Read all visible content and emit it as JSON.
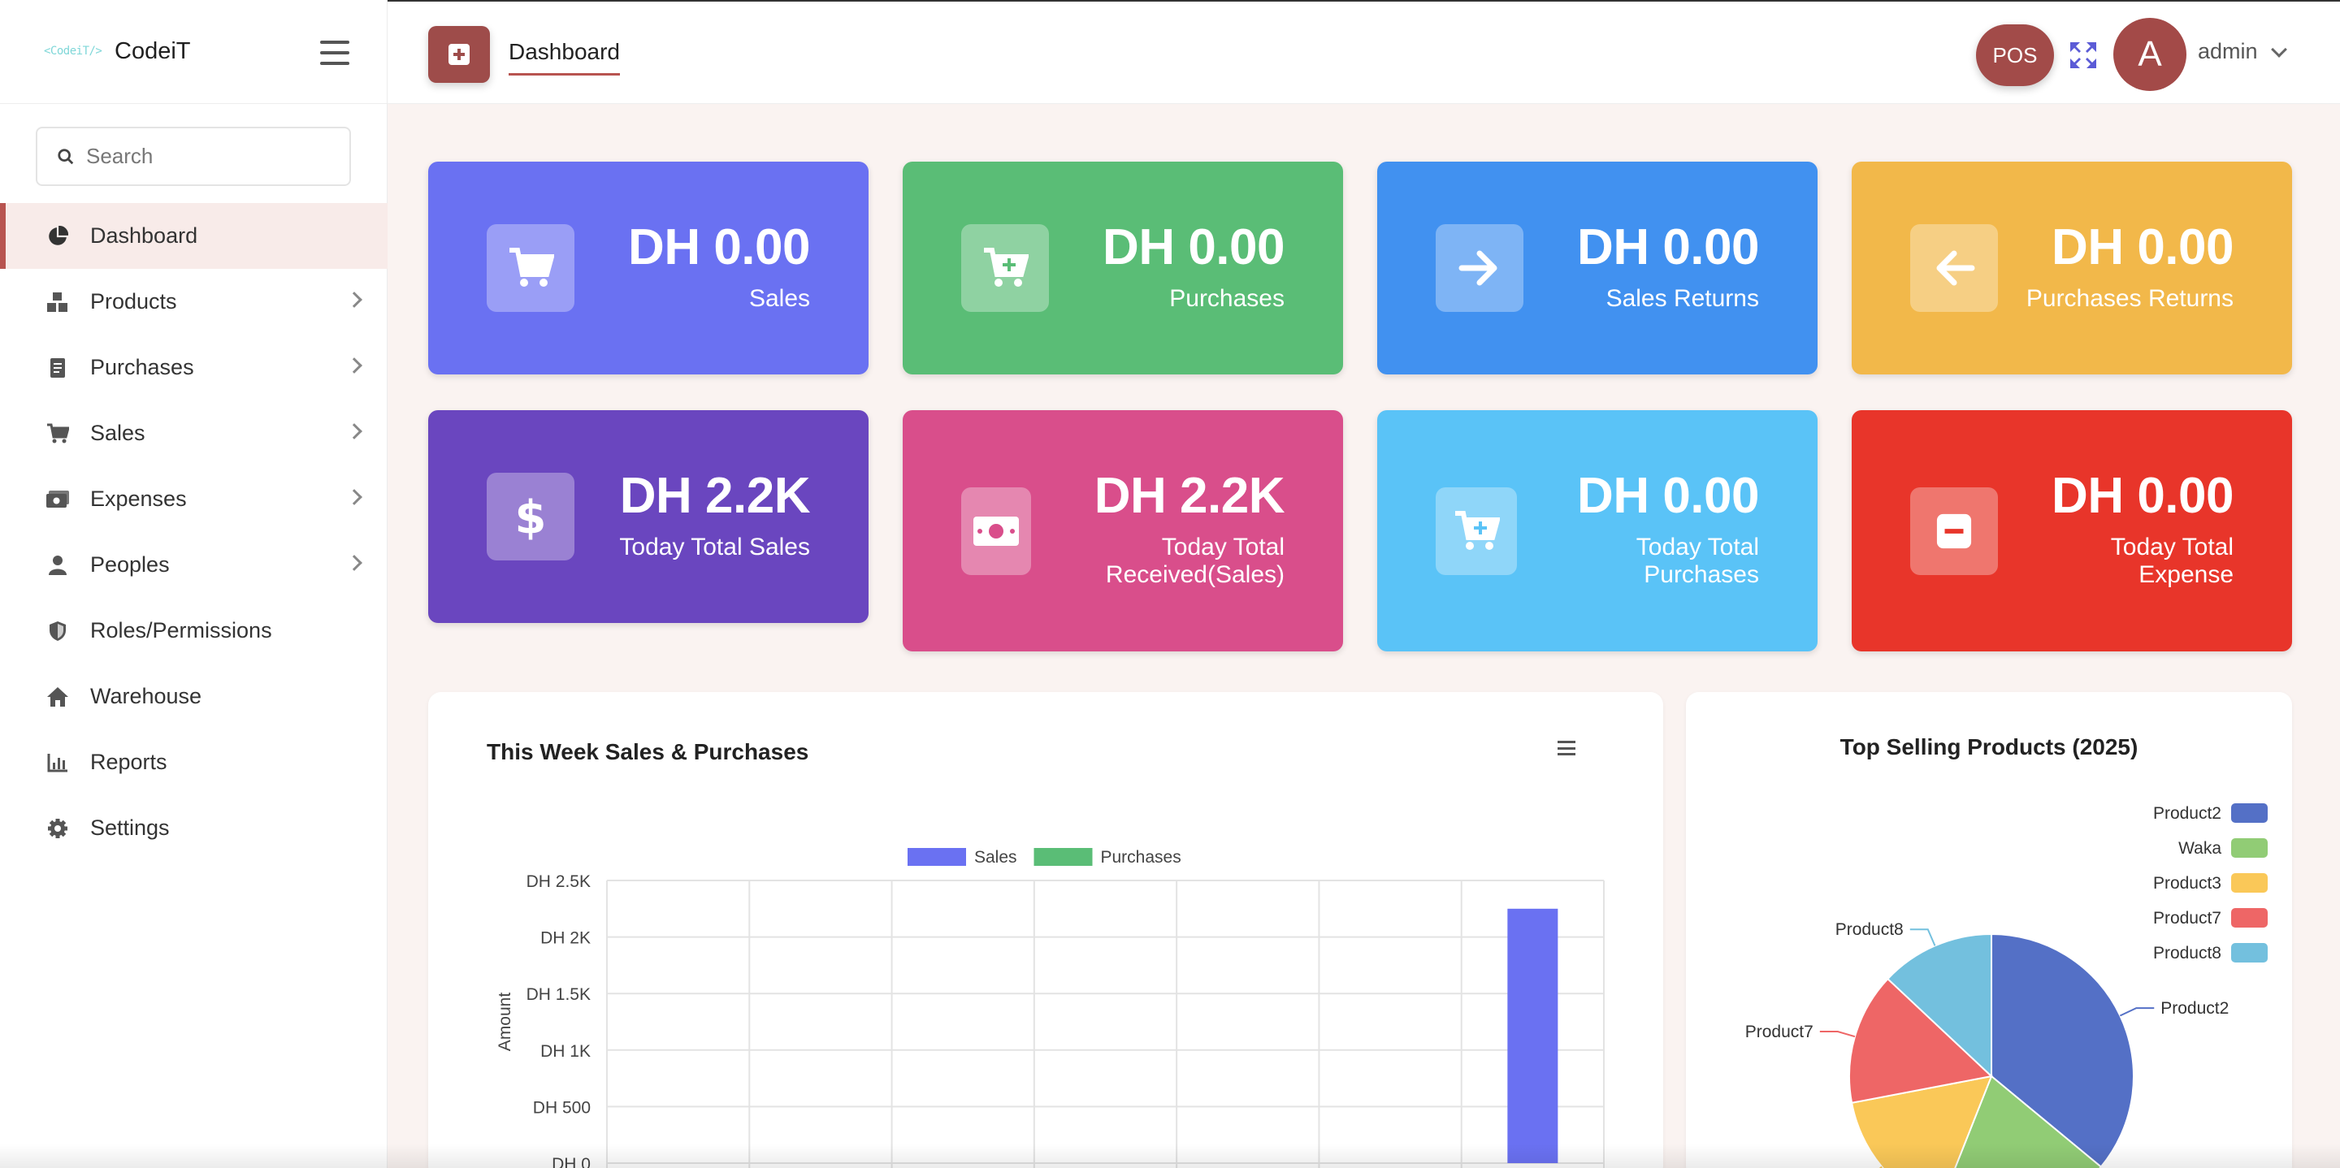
{
  "brand": {
    "logo_text": "<CodeiT/>",
    "name": "CodeiT"
  },
  "search": {
    "placeholder": "Search"
  },
  "nav": [
    {
      "label": "Dashboard",
      "icon": "pie-chart-icon",
      "active": true,
      "has_submenu": false
    },
    {
      "label": "Products",
      "icon": "boxes-icon",
      "has_submenu": true
    },
    {
      "label": "Purchases",
      "icon": "receipt-icon",
      "has_submenu": true
    },
    {
      "label": "Sales",
      "icon": "cart-icon",
      "has_submenu": true
    },
    {
      "label": "Expenses",
      "icon": "money-icon",
      "has_submenu": true
    },
    {
      "label": "Peoples",
      "icon": "user-icon",
      "has_submenu": true
    },
    {
      "label": "Roles/Permissions",
      "icon": "shield-icon",
      "has_submenu": false
    },
    {
      "label": "Warehouse",
      "icon": "home-icon",
      "has_submenu": false
    },
    {
      "label": "Reports",
      "icon": "bar-chart-icon",
      "has_submenu": false
    },
    {
      "label": "Settings",
      "icon": "gear-icon",
      "has_submenu": false
    }
  ],
  "header": {
    "title": "Dashboard",
    "pos_label": "POS",
    "avatar_letter": "A",
    "user_name": "admin"
  },
  "cards": [
    {
      "value": "DH 0.00",
      "label": "Sales",
      "color": "#6a71f2",
      "icon": "cart-icon"
    },
    {
      "value": "DH 0.00",
      "label": "Purchases",
      "color": "#5abd76",
      "icon": "cart-plus-icon"
    },
    {
      "value": "DH 0.00",
      "label": "Sales Returns",
      "color": "#4191f0",
      "icon": "arrow-right-icon"
    },
    {
      "value": "DH 0.00",
      "label": "Purchases Returns",
      "color": "#f2b84a",
      "icon": "arrow-left-icon"
    },
    {
      "value": "DH 2.2K",
      "label": "Today Total Sales",
      "color": "#6a46bf",
      "icon": "dollar-icon"
    },
    {
      "value": "DH 2.2K",
      "label": "Today Total Received(Sales)",
      "color": "#d94e8b",
      "icon": "cash-icon"
    },
    {
      "value": "DH 0.00",
      "label": "Today Total Purchases",
      "color": "#5ac3f7",
      "icon": "cart-plus-icon"
    },
    {
      "value": "DH 0.00",
      "label": "Today Total Expense",
      "color": "#e8352a",
      "icon": "minus-icon"
    }
  ],
  "sales_panel": {
    "title": "This Week Sales & Purchases"
  },
  "pie_panel": {
    "title": "Top Selling Products (2025)"
  },
  "chart_data": [
    {
      "type": "bar",
      "title": "This Week Sales & Purchases",
      "ylabel": "Amount",
      "ylim": [
        0,
        2500
      ],
      "yticks": [
        "DH 0",
        "DH 500",
        "DH 1K",
        "DH 1.5K",
        "DH 2K",
        "DH 2.5K"
      ],
      "ytick_values": [
        0,
        500,
        1000,
        1500,
        2000,
        2500
      ],
      "categories": [
        "",
        "",
        "",
        "",
        "",
        "",
        ""
      ],
      "series": [
        {
          "name": "Sales",
          "color": "#6a71f2",
          "values": [
            0,
            0,
            0,
            0,
            0,
            0,
            2250
          ]
        },
        {
          "name": "Purchases",
          "color": "#5abd76",
          "values": [
            0,
            0,
            0,
            0,
            0,
            0,
            0
          ]
        }
      ],
      "legend": "top-center",
      "grid": true
    },
    {
      "type": "pie",
      "title": "Top Selling Products (2025)",
      "legend": "top-right",
      "slices": [
        {
          "name": "Product2",
          "value": 36,
          "color": "#5470c6"
        },
        {
          "name": "Waka",
          "value": 20,
          "color": "#91cc75"
        },
        {
          "name": "Product3",
          "value": 16,
          "color": "#fac858"
        },
        {
          "name": "Product7",
          "value": 15,
          "color": "#ee6666"
        },
        {
          "name": "Product8",
          "value": 13,
          "color": "#73c0de"
        }
      ],
      "visible_slice_labels": [
        "Product8",
        "Product2",
        "Product7",
        "Product3"
      ]
    }
  ]
}
